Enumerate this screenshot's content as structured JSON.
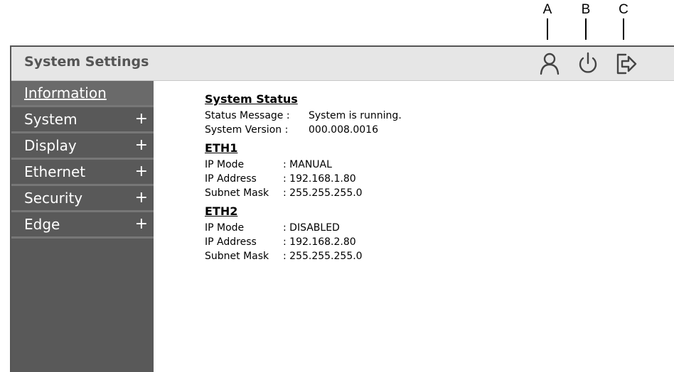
{
  "callouts": [
    "A",
    "B",
    "C"
  ],
  "header": {
    "title": "System Settings",
    "icons": [
      "user-icon",
      "power-icon",
      "logout-icon"
    ]
  },
  "sidebar": {
    "items": [
      {
        "label": "Information",
        "expand": ""
      },
      {
        "label": "System",
        "expand": "+"
      },
      {
        "label": "Display",
        "expand": "+"
      },
      {
        "label": "Ethernet",
        "expand": "+"
      },
      {
        "label": "Security",
        "expand": "+"
      },
      {
        "label": "Edge",
        "expand": "+"
      }
    ],
    "active_index": 0
  },
  "main": {
    "system_status": {
      "title": "System Status",
      "rows": [
        {
          "label": "Status Message :",
          "value": "System is running."
        },
        {
          "label": "System Version :",
          "value": "000.008.0016"
        }
      ]
    },
    "eth1": {
      "title": "ETH1",
      "rows": [
        {
          "label": "IP Mode",
          "value": ": MANUAL"
        },
        {
          "label": "IP Address",
          "value": ": 192.168.1.80"
        },
        {
          "label": "Subnet Mask",
          "value": ": 255.255.255.0"
        }
      ]
    },
    "eth2": {
      "title": "ETH2",
      "rows": [
        {
          "label": "IP Mode",
          "value": ": DISABLED"
        },
        {
          "label": "IP Address",
          "value": ": 192.168.2.80"
        },
        {
          "label": "Subnet Mask",
          "value": ": 255.255.255.0"
        }
      ]
    }
  },
  "colors": {
    "sidebar_bg": "#595959",
    "titlebar_bg": "#e6e6e6",
    "title_text": "#555555"
  }
}
